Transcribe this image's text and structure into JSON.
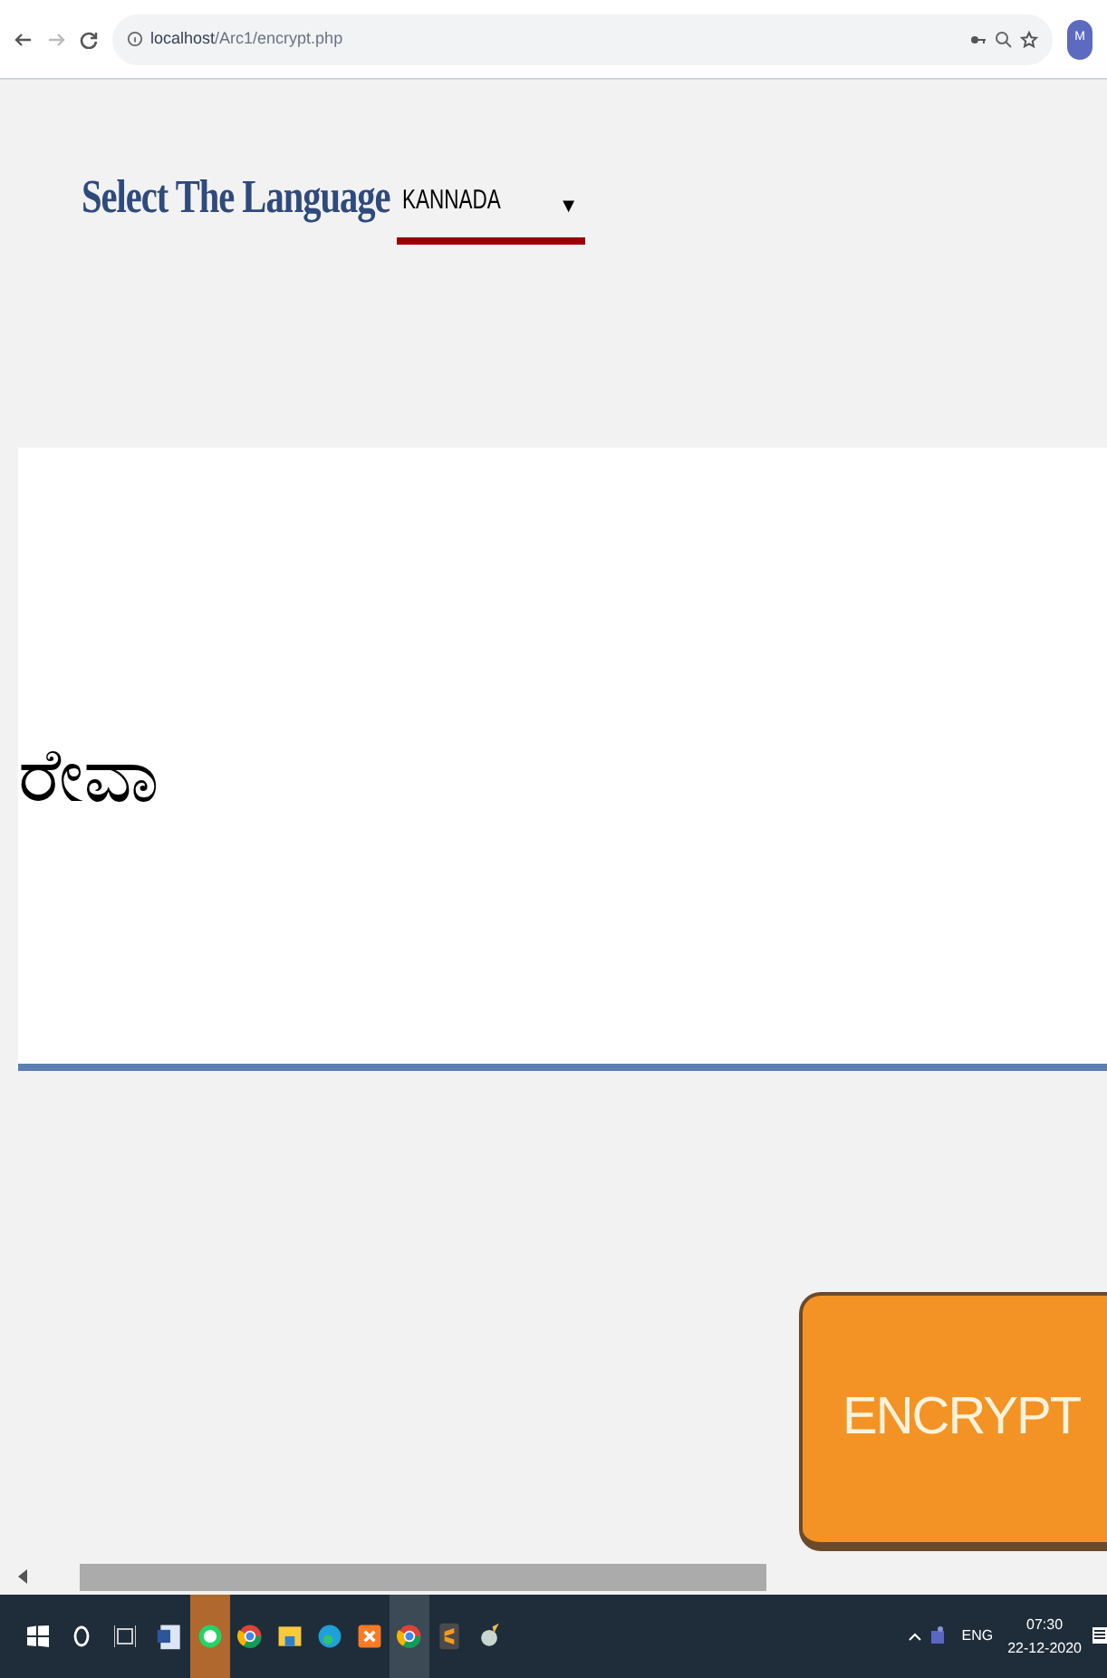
{
  "browser": {
    "url_host": "localhost",
    "url_path": "/Arc1/encrypt.php",
    "avatar": "M"
  },
  "language_select": {
    "label": "Select The Language",
    "value": "KANNADA",
    "arrow": "▼"
  },
  "output_text": "ರೇವಾ",
  "encrypt_button": {
    "label": "ENCRYPT"
  },
  "taskbar": {
    "apps": [
      {
        "kind": "word",
        "active": false
      },
      {
        "kind": "whatsapp",
        "active": true
      },
      {
        "kind": "chrome",
        "active": false
      },
      {
        "kind": "folder",
        "active": false
      },
      {
        "kind": "edge",
        "active": false
      },
      {
        "kind": "xampp",
        "active": false
      },
      {
        "kind": "chrome",
        "active": true
      },
      {
        "kind": "sublime",
        "active": false
      },
      {
        "kind": "tool",
        "active": false
      }
    ],
    "language": "ENG",
    "time": "07:30",
    "date": "22-12-2020"
  }
}
